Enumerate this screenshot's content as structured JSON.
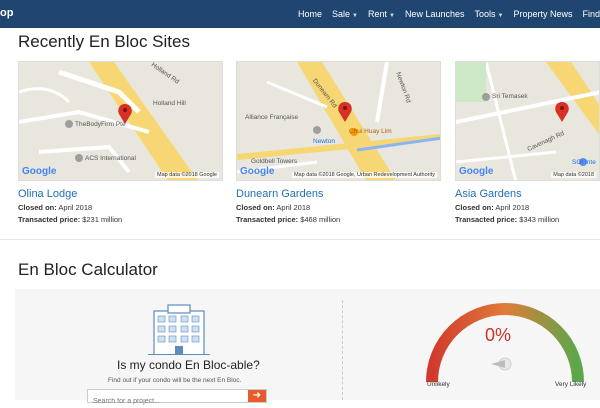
{
  "nav": {
    "brand": "op",
    "items": [
      "Home",
      "Sale",
      "Rent",
      "New Launches",
      "Tools",
      "Property News",
      "Find"
    ]
  },
  "sites_heading": "Recently En Bloc Sites",
  "sites": [
    {
      "name": "Olina Lodge",
      "closed_label": "Closed on:",
      "closed": "April 2018",
      "price_label": "Transacted price:",
      "price": "$231 million",
      "map_labels": [
        "Holland Rd",
        "TheBodyFirm Pte",
        "ACS International",
        "Holland Hill"
      ],
      "map_data": "Map data ©2018 Google",
      "google": "Google"
    },
    {
      "name": "Dunearn Gardens",
      "closed_label": "Closed on:",
      "closed": "April 2018",
      "price_label": "Transacted price:",
      "price": "$468 million",
      "map_labels": [
        "Alliance Française",
        "Chui Huay Lim",
        "Goldbell Towers",
        "Newton",
        "Dunearn Rd",
        "Newton Rd"
      ],
      "map_data": "Map data ©2018 Google, Urban Redevelopment Authority",
      "google": "Google"
    },
    {
      "name": "Asia Gardens",
      "closed_label": "Closed on:",
      "closed": "April 2018",
      "price_label": "Transacted price:",
      "price": "$343 million",
      "map_labels": [
        "Sri Temasek",
        "Cavenagh Rd",
        "SOI Inte"
      ],
      "map_data": "Map data ©2018",
      "google": "Google"
    }
  ],
  "calc_heading": "En Bloc Calculator",
  "calc": {
    "question": "Is my condo En Bloc-able?",
    "subtitle": "Find out if your condo will be the next En Bloc.",
    "search_placeholder": "Search for a project..."
  },
  "gauge": {
    "value": "0%",
    "left_label": "Unlikely",
    "right_label": "Very Likely",
    "level": 0
  },
  "colors": {
    "nav_bg": "#1f4670",
    "link": "#1f6fb5",
    "accent": "#e85a2b",
    "gauge_red": "#d03a2e",
    "gauge_green": "#5aa84a"
  }
}
